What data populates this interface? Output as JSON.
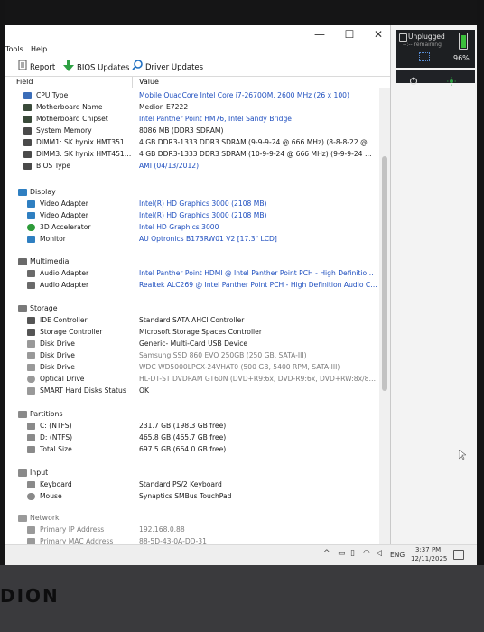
{
  "device": {
    "brand": "DION"
  },
  "window": {
    "controls": {
      "minimize": "—",
      "maximize": "☐",
      "close": "✕"
    },
    "menu": [
      "Tools",
      "Help"
    ],
    "toolbar": {
      "report": "Report",
      "bios_updates": "BIOS Updates",
      "driver_updates": "Driver Updates"
    },
    "columns": {
      "field": "Field",
      "value": "Value"
    }
  },
  "battery": {
    "status": "Unplugged",
    "remaining": "--:-- remaining",
    "percent": "96%"
  },
  "sections": {
    "motherboard_rows": [
      {
        "field": "CPU Type",
        "value": "Mobile QuadCore Intel Core i7-2670QM, 2600 MHz (26 x 100)",
        "icon_color": "#3b6db8",
        "link": true
      },
      {
        "field": "Motherboard Name",
        "value": "Medion E7222",
        "icon_color": "#3a4a3a",
        "link": false
      },
      {
        "field": "Motherboard Chipset",
        "value": "Intel Panther Point HM76, Intel Sandy Bridge",
        "icon_color": "#3a4a3a",
        "link": true
      },
      {
        "field": "System Memory",
        "value": "8086 MB  (DDR3 SDRAM)",
        "icon_color": "#4a4a4a",
        "link": false
      },
      {
        "field": "DIMM1: SK hynix HMT351S6...",
        "value": "4 GB DDR3-1333 DDR3 SDRAM  (9-9-9-24 @ 666 MHz)  (8-8-8-22 @ 60...",
        "icon_color": "#4a4a4a",
        "link": false
      },
      {
        "field": "DIMM3: SK hynix HMT451S6...",
        "value": "4 GB DDR3-1333 DDR3 SDRAM  (10-9-9-24 @ 666 MHz)  (9-9-9-24 @ 6...",
        "icon_color": "#4a4a4a",
        "link": false
      },
      {
        "field": "BIOS Type",
        "value": "AMI (04/13/2012)",
        "icon_color": "#4a4a4a",
        "link": true
      }
    ],
    "display": {
      "label": "Display",
      "rows": [
        {
          "field": "Video Adapter",
          "value": "Intel(R) HD Graphics 3000  (2108 MB)",
          "icon_color": "#2f7fc1"
        },
        {
          "field": "Video Adapter",
          "value": "Intel(R) HD Graphics 3000  (2108 MB)",
          "icon_color": "#2f7fc1"
        },
        {
          "field": "3D Accelerator",
          "value": "Intel HD Graphics 3000",
          "icon_color": "#2e9b3a"
        },
        {
          "field": "Monitor",
          "value": "AU Optronics B173RW01 V2  [17.3\" LCD]",
          "icon_color": "#2f7fc1"
        }
      ]
    },
    "multimedia": {
      "label": "Multimedia",
      "rows": [
        {
          "field": "Audio Adapter",
          "value": "Intel Panther Point HDMI @ Intel Panther Point PCH - High Definition..."
        },
        {
          "field": "Audio Adapter",
          "value": "Realtek ALC269 @ Intel Panther Point PCH - High Definition Audio Co..."
        }
      ]
    },
    "storage": {
      "label": "Storage",
      "rows": [
        {
          "field": "IDE Controller",
          "value": "Standard SATA AHCI Controller",
          "style": ""
        },
        {
          "field": "Storage Controller",
          "value": "Microsoft Storage Spaces Controller",
          "style": ""
        },
        {
          "field": "Disk Drive",
          "value": "Generic- Multi-Card USB Device",
          "style": ""
        },
        {
          "field": "Disk Drive",
          "value": "Samsung SSD 860 EVO 250GB  (250 GB, SATA-III)",
          "style": "gray"
        },
        {
          "field": "Disk Drive",
          "value": "WDC WD5000LPCX-24VHAT0  (500 GB, 5400 RPM, SATA-III)",
          "style": "gray"
        },
        {
          "field": "Optical Drive",
          "value": "HL-DT-ST DVDRAM GT60N  (DVD+R9:6x, DVD-R9:6x, DVD+RW:8x/8x, ...",
          "style": "gray"
        },
        {
          "field": "SMART Hard Disks Status",
          "value": "OK",
          "style": ""
        }
      ]
    },
    "partitions": {
      "label": "Partitions",
      "rows": [
        {
          "field": "C: (NTFS)",
          "value": "231.7 GB (198.3 GB free)"
        },
        {
          "field": "D: (NTFS)",
          "value": "465.8 GB (465.7 GB free)"
        },
        {
          "field": "Total Size",
          "value": "697.5 GB (664.0 GB free)"
        }
      ]
    },
    "input": {
      "label": "Input",
      "rows": [
        {
          "field": "Keyboard",
          "value": "Standard PS/2 Keyboard"
        },
        {
          "field": "Mouse",
          "value": "Synaptics SMBus TouchPad"
        }
      ]
    },
    "network": {
      "label": "Network",
      "rows": [
        {
          "field": "Primary IP Address",
          "value": "192.168.0.88"
        },
        {
          "field": "Primary MAC Address",
          "value": "88-5D-43-0A-DD-31"
        }
      ]
    }
  },
  "taskbar": {
    "language": "ENG",
    "time": "3:37 PM",
    "date": "12/11/2025",
    "chevron": "^"
  },
  "colors": {
    "link": "#1f4fbf",
    "accent_green": "#2ea043",
    "battery_green": "#3bbf3b"
  }
}
